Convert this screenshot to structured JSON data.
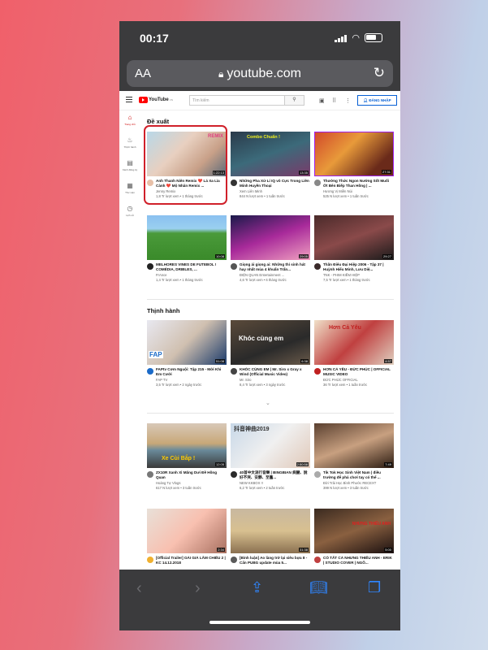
{
  "status": {
    "time": "00:17"
  },
  "browser": {
    "aa": "AA",
    "url": "youtube.com"
  },
  "yt": {
    "logo_word": "YouTube",
    "logo_region": "VN",
    "search_placeholder": "Tìm kiếm",
    "signin": "ĐĂNG NHẬP"
  },
  "sidebar": {
    "items": [
      {
        "label": "Trang chủ",
        "icon": "home-icon"
      },
      {
        "label": "Thịnh hành",
        "icon": "trending-icon"
      },
      {
        "label": "Kênh đăng ký",
        "icon": "subscriptions-icon"
      },
      {
        "label": "Thư viện",
        "icon": "library-icon"
      },
      {
        "label": "Lịch sử",
        "icon": "history-icon"
      }
    ]
  },
  "sections": {
    "recommended": "Đề xuất",
    "trending": "Thịnh hành"
  },
  "videos": [
    {
      "title": "Anh Thanh Niên Remix ❤️ Lá Xa Lìa Cành ❤️ Mộ Nhân Remix ...",
      "channel": "Jenny Remix",
      "stats": "1,8 Tr lượt xem • 1 tháng trước",
      "duration": "1:22:13",
      "thumb_text": "REMIX"
    },
    {
      "title": "Những Pha Xử Lí IQ vô Cực Trong Liên Minh Huyền Thoại",
      "channel": "Xem Liên Minh",
      "stats": "844 N lượt xem • 1 tuần trước",
      "duration": "13:35",
      "thumb_text": "Combo Chuẩn !"
    },
    {
      "title": "Thưởng Thức Ngon Nướng Sốt Muối Ớt Bên Biếp Than Hồng | ...",
      "channel": "Hương Vị Miền Núi",
      "stats": "525 N lượt xem • 1 tuần trước",
      "duration": "27:31",
      "thumb_text": ""
    },
    {
      "title": "MELHORES VINES DE FUTEBOL ! COMÉDIA, DRIBLES, ...",
      "channel": "FrAnce",
      "stats": "1,4 Tr lượt xem • 1 tháng trước",
      "duration": "10:08",
      "thumb_text": ""
    },
    {
      "title": "Giọng ải giọng ai: Những thí sinh hát hay nhất mùa 4 khuấn Trấn...",
      "channel": "ĐIỆN QUAN Entertainment ...",
      "stats": "4,6 Tr lượt xem • 6 tháng trước",
      "duration": "29:05",
      "thumb_text": ""
    },
    {
      "title": "Thần Điêu Đại Hiệp 2006 - Tập 37 | Huỳnh Hiểu Minh, Lưu Diệ...",
      "channel": "TNK - PHIM KIẾM HIỆP",
      "stats": "7,5 Tr lượt xem • 1 tháng trước",
      "duration": "29:27",
      "thumb_text": ""
    },
    {
      "title": "FAPtv Cơm Nguội: Tập 215 - Mời Khi Em Cưới",
      "channel": "FAP TV",
      "stats": "3,5 Tr lượt xem • 2 ngày trước",
      "duration": "51:08",
      "thumb_text": "FAP"
    },
    {
      "title": "KHÓC CÙNG EM | Mr. Siro x Gray x Wind (Official Music Video)",
      "channel": "Mr. Siro",
      "stats": "8,4 Tr lượt xem • 3 ngày trước",
      "duration": "6:38",
      "thumb_text": "Khóc cùng em"
    },
    {
      "title": "HƠN CẢ YÊU - ĐỨC PHÚC | OFFICIAL MUSIC VIDEO",
      "channel": "ĐỨC PHÚC OFFICIAL",
      "stats": "36 Tr lượt xem • 1 tuần trước",
      "duration": "4:57",
      "thumb_text": "Hơn Cả Yêu"
    },
    {
      "title": "ZX10R Xanh Xì Măng Dưi Đề Hồng Quan",
      "channel": "Hoàng Tự Vlogs",
      "stats": "617 N lượt xem • 3 tuần trước",
      "duration": "12:05",
      "thumb_text": "Xe Cùi Bắp !"
    },
    {
      "title": "40首中文流行音樂 | BINGBIAN 病變、說好不哭、安靜、至舊...",
      "channel": "NEW KKBOX !!",
      "stats": "6,2 Tr lượt xem • 2 tuần trước",
      "duration": "2:50:58",
      "thumb_text": "抖音神曲2019"
    },
    {
      "title": "Tik Tok Học Sinh Việt Nam | điều trường để phá chơi tay có thể ...",
      "channel": "Đời Trải Học Bình Phước RECEXT",
      "stats": "399 N lượt xem • 3 tuần trước",
      "duration": "7:49",
      "thumb_text": ""
    },
    {
      "title": "[Official Trailer] GÁI GIÀ LẮM CHIÊU 2 | KC 14.12.2018",
      "channel": "",
      "stats": "",
      "duration": "2:34",
      "thumb_text": ""
    },
    {
      "title": "[Bình luận] Ao làng trở lại siêu bựa 8 - Cẩn PUBG update mùa 5...",
      "channel": "",
      "stats": "",
      "duration": "31:38",
      "thumb_text": ""
    },
    {
      "title": "CÓ TẤT CẢ NHƯNG THIẾU ANH - ERIK | STUDIO COVER | NGÔ...",
      "channel": "",
      "stats": "",
      "duration": "5:00",
      "thumb_text": "NHƯNG THIẾU ANH"
    }
  ],
  "avatar_colors": [
    "#e8c0a8",
    "#333333",
    "#888888",
    "#222222",
    "#555555",
    "#3a2a2a",
    "#1a6ac8",
    "#444444",
    "#c02020",
    "#777777",
    "#2a2a2a",
    "#aaaaaa",
    "#f0b030",
    "#5a5a5a",
    "#c04040"
  ],
  "accent": {
    "youtube_red": "#ff0000",
    "ios_blue": "#2f86ff",
    "highlight": "#d0202a"
  }
}
